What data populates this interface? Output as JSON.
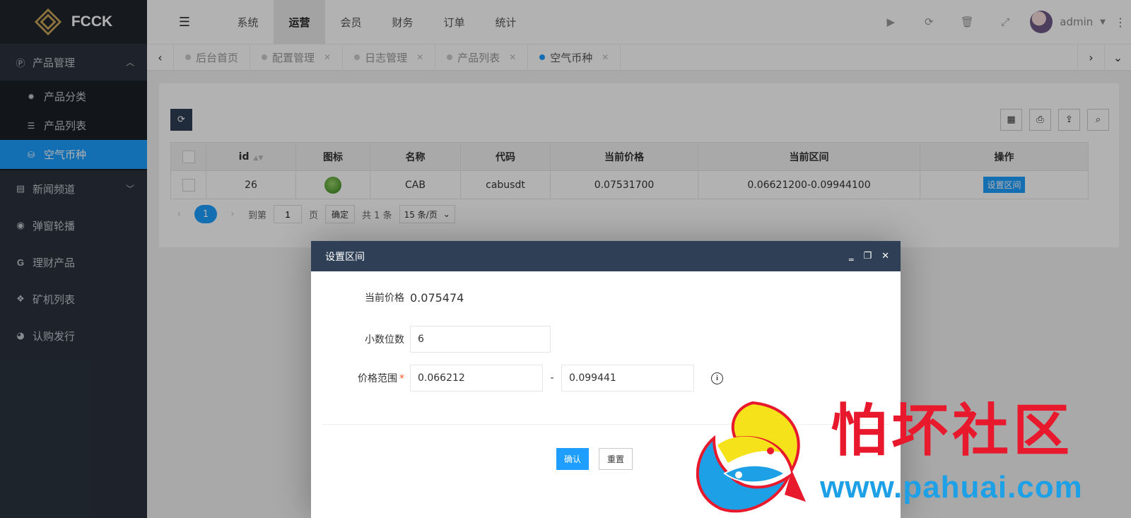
{
  "app": {
    "logo_text": "FCCK"
  },
  "sidebar": {
    "groups": [
      {
        "label": "产品管理",
        "icon": "p-circle-icon",
        "expanded": true,
        "items": [
          {
            "label": "产品分类",
            "icon": "gear-icon"
          },
          {
            "label": "产品列表",
            "icon": "list-icon"
          },
          {
            "label": "空气币种",
            "icon": "coin-icon",
            "active": true
          }
        ]
      },
      {
        "label": "新闻频道",
        "icon": "news-icon",
        "expanded": false
      },
      {
        "label": "弹窗轮播",
        "icon": "compass-icon"
      },
      {
        "label": "理财产品",
        "icon": "g-icon"
      },
      {
        "label": "矿机列表",
        "icon": "cubes-icon"
      },
      {
        "label": "认购发行",
        "icon": "pie-icon"
      }
    ]
  },
  "topbar": {
    "menu": [
      "系统",
      "运营",
      "会员",
      "财务",
      "订单",
      "统计"
    ],
    "active_menu": "运营",
    "user": "admin"
  },
  "tabs": [
    {
      "label": "后台首页",
      "closable": false
    },
    {
      "label": "配置管理",
      "closable": true
    },
    {
      "label": "日志管理",
      "closable": true
    },
    {
      "label": "产品列表",
      "closable": true
    },
    {
      "label": "空气币种",
      "closable": true,
      "active": true
    }
  ],
  "table": {
    "columns": [
      "id",
      "图标",
      "名称",
      "代码",
      "当前价格",
      "当前区间",
      "操作"
    ],
    "rows": [
      {
        "id": "26",
        "name": "CAB",
        "code": "cabusdt",
        "price": "0.07531700",
        "range": "0.06621200-0.09944100",
        "action": "设置区间"
      }
    ]
  },
  "pager": {
    "current": "1",
    "goto_label": "到第",
    "goto_value": "1",
    "page_label": "页",
    "confirm": "确定",
    "total": "共 1 条",
    "page_size": "15 条/页"
  },
  "dialog": {
    "title": "设置区间",
    "price_label": "当前价格",
    "price_value": "0.075474",
    "decimals_label": "小数位数",
    "decimals_value": "6",
    "range_label": "价格范围",
    "range_min": "0.066212",
    "range_sep": "-",
    "range_max": "0.099441",
    "confirm": "确认",
    "reset": "重置"
  },
  "watermark": {
    "title": "怕坏社区",
    "url": "www.pahuai.com"
  },
  "colors": {
    "accent": "#1e9fff",
    "sidebar": "#2b333e",
    "dialog_header": "#2f4056",
    "watermark_red": "#e8192c",
    "watermark_blue": "#1ea0e6"
  }
}
